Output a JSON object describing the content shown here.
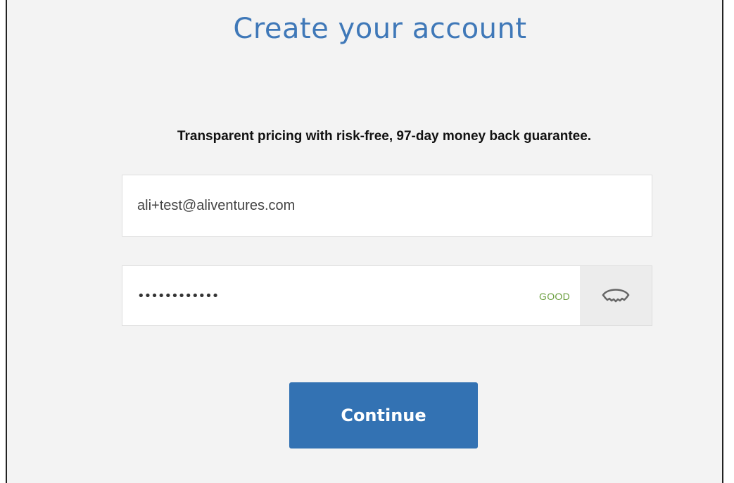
{
  "page": {
    "title": "Create your account",
    "tagline": "Transparent pricing with risk-free, 97-day money back guarantee."
  },
  "form": {
    "email_value": "ali+test@aliventures.com",
    "password_masked": "••••••••••••",
    "password_strength": "GOOD",
    "show_password_icon": "eye-icon",
    "continue_label": "Continue"
  },
  "colors": {
    "accent": "#3372b3",
    "title": "#3f78b8",
    "strength_good": "#6a9e3e",
    "background": "#f3f3f3"
  }
}
